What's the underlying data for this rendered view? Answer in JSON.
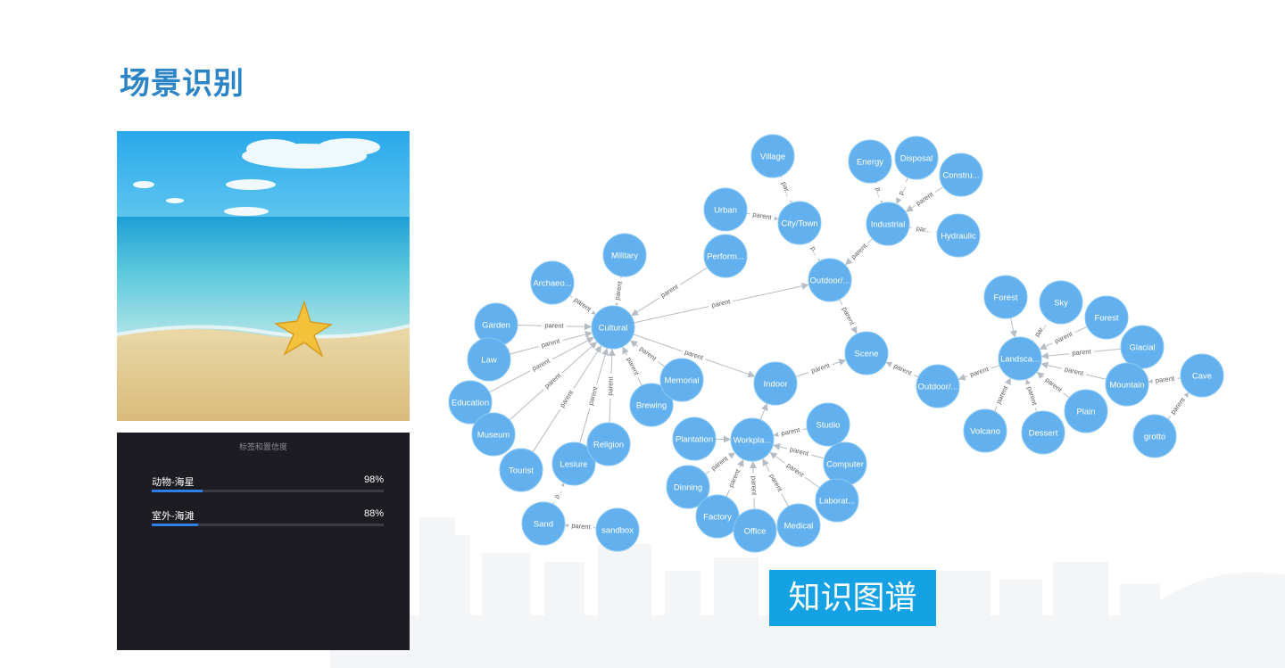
{
  "page": {
    "title": "场景识别"
  },
  "photo": {
    "description_icon": "beach-starfish-photo",
    "colors": {
      "sky": "#3fb6ec",
      "sea": "#7fd3e4",
      "sand": "#e6cf98",
      "starfish": "#f2c23a"
    }
  },
  "recognition_panel": {
    "title": "标签和置信度",
    "rows": [
      {
        "label": "动物-海星",
        "value": "98%",
        "fraction": 0.22
      },
      {
        "label": "室外-海滩",
        "value": "88%",
        "fraction": 0.2
      }
    ]
  },
  "knowledge_graph": {
    "banner_label": "知识图谱",
    "colors": {
      "node": "#62b1ee",
      "edge": "#b5bcc3",
      "banner": "#14a2e5"
    },
    "nodes": [
      {
        "id": "village",
        "label": "Village"
      },
      {
        "id": "energy",
        "label": "Energy"
      },
      {
        "id": "disposal",
        "label": "Disposal"
      },
      {
        "id": "constru",
        "label": "Constru..."
      },
      {
        "id": "urban",
        "label": "Urban"
      },
      {
        "id": "citytown",
        "label": "City/Town"
      },
      {
        "id": "industrial",
        "label": "Industrial"
      },
      {
        "id": "hydraulic",
        "label": "Hydraulic"
      },
      {
        "id": "military",
        "label": "Military"
      },
      {
        "id": "perform",
        "label": "Perform..."
      },
      {
        "id": "outdoor1",
        "label": "Outdoor/..."
      },
      {
        "id": "archaeo",
        "label": "Archaeo..."
      },
      {
        "id": "cultural",
        "label": "Cultural"
      },
      {
        "id": "garden",
        "label": "Garden"
      },
      {
        "id": "law",
        "label": "Law"
      },
      {
        "id": "education",
        "label": "Education"
      },
      {
        "id": "museum",
        "label": "Museum"
      },
      {
        "id": "tourist",
        "label": "Tourist"
      },
      {
        "id": "lesiure",
        "label": "Lesiure"
      },
      {
        "id": "religion",
        "label": "Religion"
      },
      {
        "id": "brewing",
        "label": "Brewing"
      },
      {
        "id": "memorial",
        "label": "Memorial"
      },
      {
        "id": "indoor",
        "label": "Indoor"
      },
      {
        "id": "scene",
        "label": "Scene"
      },
      {
        "id": "outdoor2",
        "label": "Outdoor/..."
      },
      {
        "id": "landsca",
        "label": "Landsca..."
      },
      {
        "id": "forest1",
        "label": "Forest"
      },
      {
        "id": "sky",
        "label": "Sky"
      },
      {
        "id": "forest2",
        "label": "Forest"
      },
      {
        "id": "glacial",
        "label": "Glacial"
      },
      {
        "id": "mountain",
        "label": "Mountain"
      },
      {
        "id": "cave",
        "label": "Cave"
      },
      {
        "id": "plain",
        "label": "Plain"
      },
      {
        "id": "dessert",
        "label": "Dessert"
      },
      {
        "id": "volcano",
        "label": "Volcano"
      },
      {
        "id": "grotto",
        "label": "grotto"
      },
      {
        "id": "studio",
        "label": "Studio"
      },
      {
        "id": "plantation",
        "label": "Plantation"
      },
      {
        "id": "workpla",
        "label": "Workpla..."
      },
      {
        "id": "computer",
        "label": "Computer"
      },
      {
        "id": "laborat",
        "label": "Laborat..."
      },
      {
        "id": "dinning",
        "label": "Dinning"
      },
      {
        "id": "factory",
        "label": "Factory"
      },
      {
        "id": "office",
        "label": "Office"
      },
      {
        "id": "medical",
        "label": "Medical"
      },
      {
        "id": "sand",
        "label": "Sand"
      },
      {
        "id": "sandbox",
        "label": "sandbox"
      }
    ],
    "edges": [
      {
        "from": "village",
        "to": "citytown",
        "label": "par..."
      },
      {
        "from": "urban",
        "to": "citytown",
        "label": "parent"
      },
      {
        "from": "citytown",
        "to": "outdoor1",
        "label": "p..."
      },
      {
        "from": "energy",
        "to": "industrial",
        "label": "p..."
      },
      {
        "from": "disposal",
        "to": "industrial",
        "label": "p..."
      },
      {
        "from": "constru",
        "to": "industrial",
        "label": "parent"
      },
      {
        "from": "hydraulic",
        "to": "industrial",
        "label": "par..."
      },
      {
        "from": "industrial",
        "to": "outdoor1",
        "label": "parent"
      },
      {
        "from": "cultural",
        "to": "outdoor1",
        "label": "parent"
      },
      {
        "from": "outdoor1",
        "to": "scene",
        "label": "parent"
      },
      {
        "from": "military",
        "to": "cultural",
        "label": "parent"
      },
      {
        "from": "perform",
        "to": "cultural",
        "label": "parent"
      },
      {
        "from": "archaeo",
        "to": "cultural",
        "label": "parent"
      },
      {
        "from": "garden",
        "to": "cultural",
        "label": "parent"
      },
      {
        "from": "law",
        "to": "cultural",
        "label": "parent"
      },
      {
        "from": "education",
        "to": "cultural",
        "label": "parent"
      },
      {
        "from": "museum",
        "to": "cultural",
        "label": "parent"
      },
      {
        "from": "tourist",
        "to": "cultural",
        "label": "parent"
      },
      {
        "from": "lesiure",
        "to": "cultural",
        "label": "parent"
      },
      {
        "from": "religion",
        "to": "cultural",
        "label": "parent"
      },
      {
        "from": "brewing",
        "to": "cultural",
        "label": "parent"
      },
      {
        "from": "memorial",
        "to": "cultural",
        "label": "parent"
      },
      {
        "from": "cultural",
        "to": "indoor",
        "label": "parent"
      },
      {
        "from": "indoor",
        "to": "scene",
        "label": "parent"
      },
      {
        "from": "outdoor2",
        "to": "scene",
        "label": "parent"
      },
      {
        "from": "landsca",
        "to": "outdoor2",
        "label": "parent"
      },
      {
        "from": "forest1",
        "to": "landsca",
        "label": ""
      },
      {
        "from": "sky",
        "to": "landsca",
        "label": "par..."
      },
      {
        "from": "forest2",
        "to": "landsca",
        "label": "parent"
      },
      {
        "from": "glacial",
        "to": "landsca",
        "label": "parent"
      },
      {
        "from": "mountain",
        "to": "landsca",
        "label": "parent"
      },
      {
        "from": "plain",
        "to": "landsca",
        "label": "parent"
      },
      {
        "from": "dessert",
        "to": "landsca",
        "label": "parent"
      },
      {
        "from": "volcano",
        "to": "landsca",
        "label": "parent"
      },
      {
        "from": "cave",
        "to": "mountain",
        "label": "parent"
      },
      {
        "from": "grotto",
        "to": "cave",
        "label": "parent"
      },
      {
        "from": "workpla",
        "to": "indoor",
        "label": ""
      },
      {
        "from": "studio",
        "to": "workpla",
        "label": "parent"
      },
      {
        "from": "plantation",
        "to": "workpla",
        "label": ""
      },
      {
        "from": "computer",
        "to": "workpla",
        "label": "parent"
      },
      {
        "from": "laborat",
        "to": "workpla",
        "label": "parent"
      },
      {
        "from": "dinning",
        "to": "workpla",
        "label": "parent"
      },
      {
        "from": "factory",
        "to": "workpla",
        "label": "parent"
      },
      {
        "from": "office",
        "to": "workpla",
        "label": "parent"
      },
      {
        "from": "medical",
        "to": "workpla",
        "label": "parent"
      },
      {
        "from": "sand",
        "to": "lesiure",
        "label": "p..."
      },
      {
        "from": "sandbox",
        "to": "sand",
        "label": "parent"
      }
    ]
  }
}
